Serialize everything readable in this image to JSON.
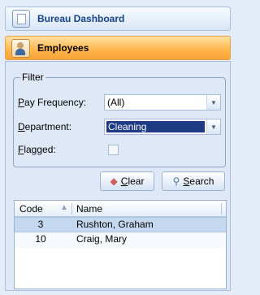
{
  "nav": {
    "bureau_label": "Bureau Dashboard",
    "employees_label": "Employees"
  },
  "filter": {
    "legend": "Filter",
    "pay_frequency": {
      "label_first": "P",
      "label_rest": "ay Frequency:",
      "value": "(All)"
    },
    "department": {
      "label_first": "D",
      "label_rest": "epartment:",
      "value": "Cleaning"
    },
    "flagged": {
      "label_first": "F",
      "label_rest": "lagged:",
      "checked": false
    }
  },
  "buttons": {
    "clear": {
      "label_first": "C",
      "label_rest": "lear"
    },
    "search": {
      "label_first": "S",
      "label_rest": "earch"
    }
  },
  "grid": {
    "columns": [
      "Code",
      "Name"
    ],
    "rows": [
      {
        "code": "3",
        "name": "Rushton, Graham"
      },
      {
        "code": "10",
        "name": "Craig, Mary"
      }
    ]
  },
  "colors": {
    "accent_orange": "#ffb54a",
    "selected_blue": "#1f3a84",
    "row_selected": "#c4d8f0"
  }
}
